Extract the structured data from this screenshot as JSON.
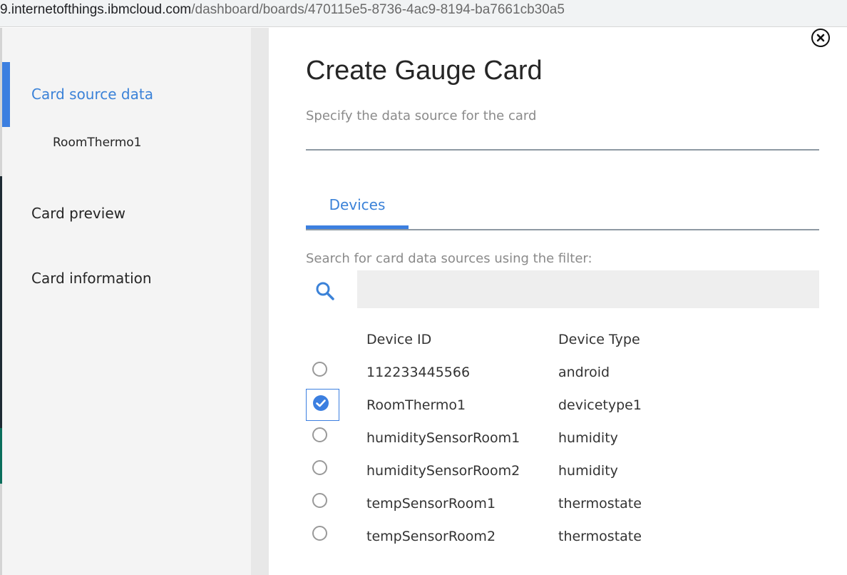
{
  "browser": {
    "url_host": "9.internetofthings.ibmcloud.com",
    "url_path": "/dashboard/boards/470115e5-8736-4ac9-8194-ba7661cb30a5"
  },
  "sidebar": {
    "items": [
      {
        "label": "Card source data",
        "active": true
      },
      {
        "label": "Card preview",
        "active": false
      },
      {
        "label": "Card information",
        "active": false
      }
    ],
    "selected_source": "RoomThermo1"
  },
  "dialog": {
    "title": "Create Gauge Card",
    "subtitle": "Specify the data source for the card",
    "tabs": [
      {
        "label": "Devices",
        "active": true
      }
    ],
    "filter_label": "Search for card data sources using the filter:",
    "search": {
      "value": "",
      "placeholder": ""
    }
  },
  "devices_table": {
    "columns": [
      "Device ID",
      "Device Type"
    ],
    "rows": [
      {
        "id": "112233445566",
        "type": "android",
        "selected": false
      },
      {
        "id": "RoomThermo1",
        "type": "devicetype1",
        "selected": true
      },
      {
        "id": "humiditySensorRoom1",
        "type": "humidity",
        "selected": false
      },
      {
        "id": "humiditySensorRoom2",
        "type": "humidity",
        "selected": false
      },
      {
        "id": "tempSensorRoom1",
        "type": "thermostate",
        "selected": false
      },
      {
        "id": "tempSensorRoom2",
        "type": "thermostate",
        "selected": false
      }
    ]
  },
  "icons": {
    "close": "close-circle-icon",
    "search": "search-icon",
    "check": "checkmark-circle-icon"
  },
  "colors": {
    "accent": "#3c7fe0",
    "link_text": "#3b82d8",
    "sidebar_bg": "#f4f4f4",
    "input_bg": "#eeeeee"
  }
}
